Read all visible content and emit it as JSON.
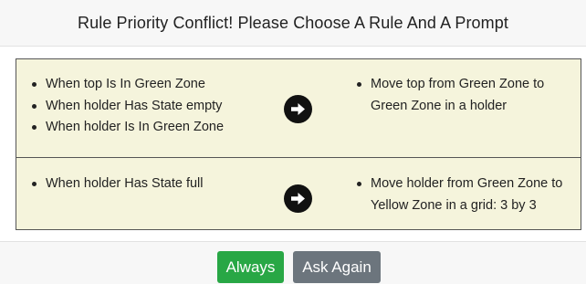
{
  "dialog": {
    "title": "Rule Priority Conflict! Please Choose A Rule And A Prompt"
  },
  "rules": [
    {
      "conditions": [
        "When top Is In Green Zone",
        "When holder Has State empty",
        "When holder Is In Green Zone"
      ],
      "arrow_icon": "arrow-right-circle-icon",
      "prompt": "Move top from Green Zone to Green Zone in a holder"
    },
    {
      "conditions": [
        "When holder Has State full"
      ],
      "arrow_icon": "arrow-right-circle-icon",
      "prompt": "Move holder from Green Zone to Yellow Zone in a grid: 3 by 3"
    }
  ],
  "buttons": {
    "always": "Always",
    "ask_again": "Ask Again"
  },
  "colors": {
    "rule_background": "#f5f4dc",
    "always_button": "#28a745",
    "ask_again_button": "#6c757d"
  }
}
